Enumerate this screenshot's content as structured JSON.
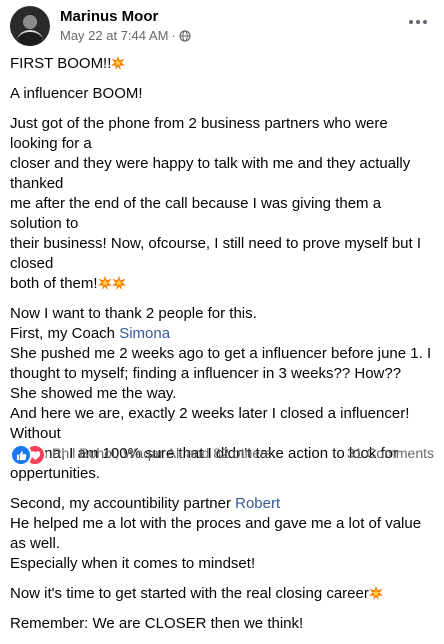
{
  "post": {
    "author": "Marinus Moor",
    "timestamp": "May 22 at 7:44 AM",
    "meta_separator": "·",
    "privacy_icon": "globe-icon",
    "more_icon": "more-horizontal-icon",
    "title_line": "FIRST BOOM!!",
    "subtitle_line": "A influencer BOOM!",
    "para1": [
      "Just got of the phone from 2 business partners who were looking for a",
      "closer and they were happy to talk with me and they actually thanked",
      "me after the end of the call because I was giving them a solution to",
      "their business! Now, ofcourse, I still need to prove myself but I closed",
      "both of them!"
    ],
    "para2_intro": "Now I want to thank 2 people for this.",
    "para2_first_prefix": "First, my Coach ",
    "mention_1": "Simona",
    "para2_lines": [
      "She pushed me 2 weeks ago to get a influencer before june 1. I",
      "thought to myself; finding a influencer in 3 weeks?? How??",
      "She showed me the way.",
      "And here we are, exactly 2 weeks later I closed a influencer! Without",
      "Simona, I am 100% sure that I didn't take action to look for",
      "oppertunities."
    ],
    "para3_prefix": "Second, my accountibility partner ",
    "mention_2": "Robert",
    "para3_lines": [
      "He helped me a lot with the proces and gave me a lot of value as well.",
      "Especially when it comes to mindset!"
    ],
    "para4": "Now it's time to get started with the real closing career",
    "para5": "Remember: We are CLOSER then we think!",
    "emoji": "collision-emoji"
  },
  "footer": {
    "reactions": [
      "like",
      "love"
    ],
    "reaction_names": "Phil Bohol, Waqar Ali and 82 others",
    "comments": "31 Comments"
  },
  "colors": {
    "text": "#050505",
    "secondary": "#65676b",
    "mention": "#385898",
    "like": "#1877f2",
    "love": "#f33e58",
    "boom": "#ff7a00"
  }
}
